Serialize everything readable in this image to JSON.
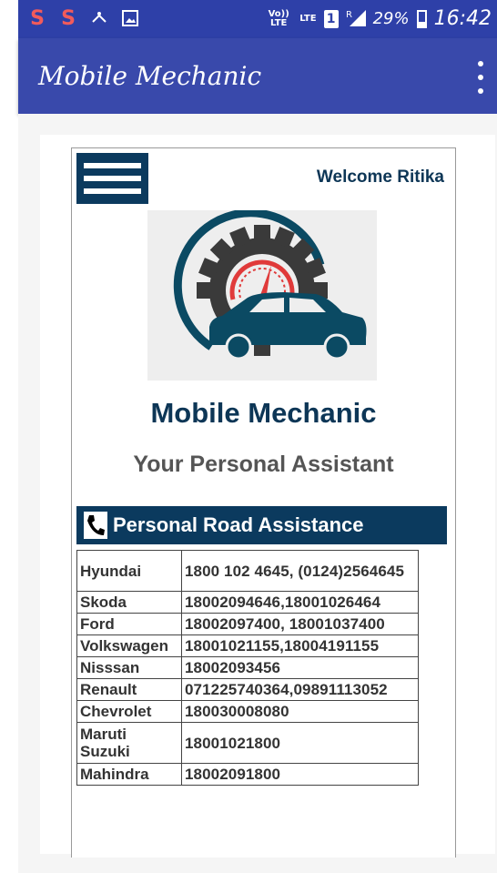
{
  "status_bar": {
    "left_icons": [
      "s-icon",
      "s-icon",
      "usb-icon",
      "image-icon"
    ],
    "volte": "Vo)) LTE",
    "lte": "LTE",
    "sim": "1",
    "roaming": "R",
    "battery": "29%",
    "time": "16:42"
  },
  "appbar": {
    "title": "Mobile Mechanic",
    "menu_icon": "overflow-menu-icon"
  },
  "header": {
    "menu_icon": "hamburger-icon",
    "welcome": "Welcome Ritika"
  },
  "brand": {
    "logo_icon": "gear-car-logo",
    "title": "Mobile Mechanic",
    "subtitle": "Your Personal Assistant"
  },
  "assistance": {
    "icon": "phone-icon",
    "title": "Personal Road Assistance",
    "rows": [
      {
        "brand": "Hyundai",
        "number": "1800 102 4645, (0124)2564645"
      },
      {
        "brand": "Skoda",
        "number": "18002094646,18001026464"
      },
      {
        "brand": "Ford",
        "number": "18002097400, 18001037400"
      },
      {
        "brand": "Volkswagen",
        "number": "18001021155,18004191155"
      },
      {
        "brand": "Nisssan",
        "number": "18002093456"
      },
      {
        "brand": "Renault",
        "number": "071225740364,09891113052"
      },
      {
        "brand": "Chevrolet",
        "number": "180030008080"
      },
      {
        "brand": "Maruti Suzuki",
        "number": "18001021800"
      },
      {
        "brand": "Mahindra",
        "number": "18002091800"
      }
    ]
  },
  "colors": {
    "status_bar": "#2e40a8",
    "app_bar": "#3949ab",
    "navy": "#0b3a5e",
    "title_text": "#0d3656",
    "logo_red": "#e03a3a"
  }
}
